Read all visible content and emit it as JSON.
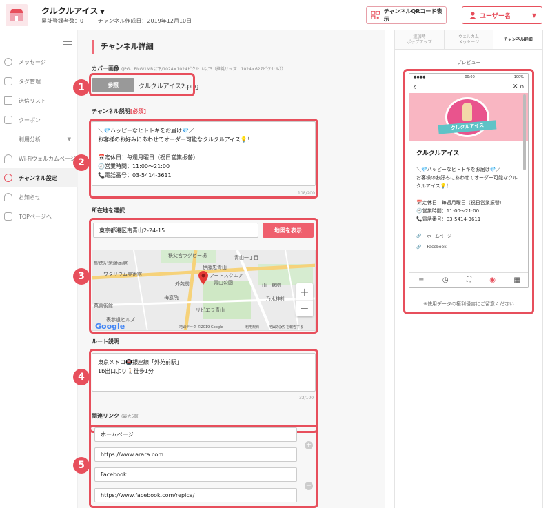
{
  "header": {
    "store_name": "クルクルアイス",
    "member_count": "累計登録者数：0",
    "created": "チャンネル作成日：2019年12月10日",
    "qr_button": "チャンネルQRコード表示",
    "user_button": "ユーザー名"
  },
  "sidebar": {
    "items": [
      {
        "label": "メッセージ"
      },
      {
        "label": "タグ管理"
      },
      {
        "label": "送信リスト"
      },
      {
        "label": "クーポン"
      },
      {
        "label": "利用分析"
      },
      {
        "label": "Wi-Fiウェルカムページ"
      },
      {
        "label": "チャンネル設定"
      },
      {
        "label": "お知らせ"
      },
      {
        "label": "TOPページへ"
      }
    ]
  },
  "main": {
    "title": "チャンネル詳細",
    "cover": {
      "label": "カバー画像",
      "hint": "(JPG、PNG/1MB以下/1024×1024ピクセル以下（推奨サイズ：1024×627ピクセル））",
      "browse_button": "参照",
      "file_name": "クルクルアイス2.png"
    },
    "description": {
      "label": "チャンネル説明",
      "required": "[必須]",
      "lines": [
        "＼💎ハッピーなヒトトキをお届け💎／",
        "お客様のお好みにあわせてオーダー可能なクルクルアイス💡！",
        "",
        "📅定休日：毎週月曜日（祝日営業振替）",
        "🕘営業時間：11:00～21:00",
        "📞電話番号：03-5414-3611"
      ],
      "counter": "108/200"
    },
    "location": {
      "label": "所在地を選択",
      "address": "東京都港区南青山2-24-15",
      "map_button": "地図を表示",
      "map_words": [
        "秩父宮ラグビー場",
        "青山一丁目",
        "聖徳記念絵画館",
        "伊藤忠青山",
        "ワタリウム美術館",
        "外苑前",
        "アートスクエア",
        "青山公園",
        "山王病院",
        "梅窓院",
        "乃木神社",
        "リビエラ青山",
        "菓美術館",
        "表参道ヒルズ",
        "Google",
        "地図データ ©2019 Google",
        "利用規約",
        "地図の誤りを報告する"
      ]
    },
    "route": {
      "label": "ルート説明",
      "lines": [
        "東京メトロ🚇銀座線「外苑前駅」",
        "1b出口より🚶徒歩1分"
      ],
      "counter": "32/100"
    },
    "links": {
      "label": "関連リンク",
      "hint": "(最大5個)",
      "values": [
        "ホームページ",
        "https://www.arara.com",
        "Facebook",
        "https://www.facebook.com/repica/"
      ]
    }
  },
  "preview": {
    "tabs": [
      "追加時\nポップアップ",
      "ウェルカム\nメッセージ",
      "チャンネル詳細"
    ],
    "label": "プレビュー",
    "status_time": "00:00",
    "battery": "100%",
    "cover_banner": "クルクルアイス",
    "name": "クルクルアイス",
    "description": "＼💎ハッピーなヒトトキをお届け💎／\nお客様のお好みにあわせてオーダー可能なクルクルアイス💡！\n\n📅定休日：毎週月曜日（祝日営業振替）\n🕘営業時間：11:00～21:00\n📞電話番号：03-5414-3611",
    "links": [
      "ホームページ",
      "Facebook"
    ],
    "notice": "※使用データの権利侵害にご留意ください"
  },
  "annotations": [
    "1",
    "2",
    "3",
    "4",
    "5"
  ],
  "colors": {
    "accent": "#e74f5c",
    "button_red": "#ef5f6d"
  }
}
